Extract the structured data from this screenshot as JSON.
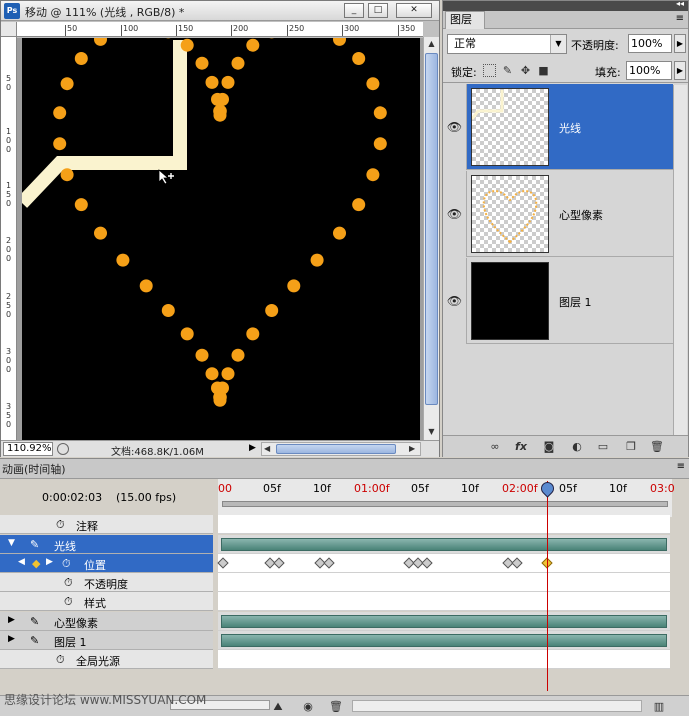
{
  "document": {
    "title": "移动 @ 111% (光线 , RGB/8) *",
    "ps_logo": "Ps",
    "window_buttons": {
      "minimize": "_",
      "restore": "□",
      "close": "✕"
    },
    "ruler_h": [
      "50",
      "100",
      "150",
      "200",
      "250",
      "300",
      "350"
    ],
    "ruler_v": [
      "5",
      "0",
      "1",
      "0",
      "0",
      "1",
      "5",
      "0",
      "2",
      "0",
      "0",
      "2",
      "5",
      "0",
      "3",
      "0",
      "0",
      "3",
      "5",
      "0"
    ],
    "zoom": "110.92%",
    "doc_info": "文档:468.8K/1.06M"
  },
  "layers_panel": {
    "tab": "图层",
    "blend_mode": "正常",
    "opacity_label": "不透明度:",
    "opacity_value": "100%",
    "lock_label": "锁定:",
    "fill_label": "填充:",
    "fill_value": "100%",
    "layers": [
      {
        "name": "光线",
        "selected": true
      },
      {
        "name": "心型像素",
        "selected": false
      },
      {
        "name": "图层 1",
        "selected": false
      }
    ],
    "footer_icons": [
      "link-icon",
      "fx-icon",
      "mask-icon",
      "adjustment-icon",
      "folder-icon",
      "new-layer-icon",
      "trash-icon"
    ]
  },
  "animation": {
    "tab": "动画(时间轴)",
    "timecode": "0:00:02:03",
    "fps": "(15.00 fps)",
    "ruler_labels": [
      {
        "text": "00",
        "red": true
      },
      {
        "text": "05f",
        "red": false
      },
      {
        "text": "10f",
        "red": false
      },
      {
        "text": "01:00f",
        "red": true
      },
      {
        "text": "05f",
        "red": false
      },
      {
        "text": "10f",
        "red": false
      },
      {
        "text": "02:00f",
        "red": true
      },
      {
        "text": "05f",
        "red": false
      },
      {
        "text": "10f",
        "red": false
      },
      {
        "text": "03:0",
        "red": true
      }
    ],
    "tracks": {
      "comments": "注释",
      "layer_guangxian": "光线",
      "position": "位置",
      "opacity": "不透明度",
      "style": "样式",
      "layer_heart": "心型像素",
      "layer_1": "图层 1",
      "global_light": "全局光源"
    },
    "watermark": "思缘设计论坛 www.MISSYUAN.COM"
  },
  "colors": {
    "selection": "#316ac5",
    "heart_dot": "#f5a018",
    "line": "#faf3cf",
    "playhead": "#cc0000",
    "layer_bar": "#4a8378"
  }
}
